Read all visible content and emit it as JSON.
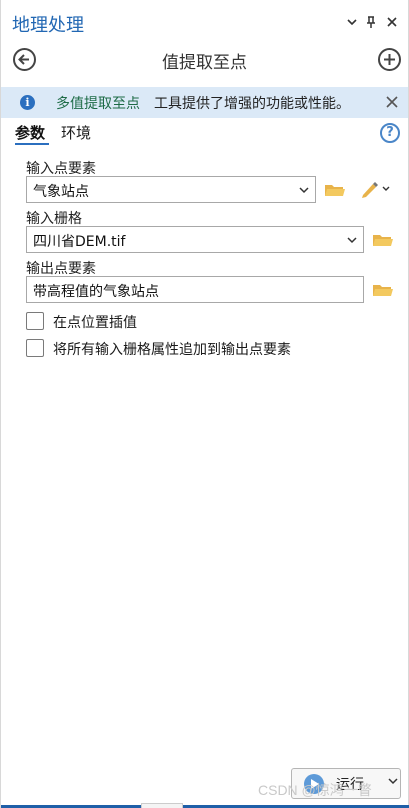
{
  "pane": {
    "title": "地理处理",
    "controls": {
      "menu_icon": "chevron-down-icon",
      "pin_icon": "pin-icon",
      "close_icon": "close-icon"
    }
  },
  "nav": {
    "tool_title": "值提取至点",
    "back_icon": "back-arrow-icon",
    "add_icon": "add-circle-icon"
  },
  "banner": {
    "link_text": "多值提取至点",
    "message": "工具提供了增强的功能或性能。",
    "icon": "info-icon"
  },
  "tabs": [
    {
      "label": "参数",
      "active": true
    },
    {
      "label": "环境",
      "active": false
    }
  ],
  "params": {
    "input_points": {
      "label": "输入点要素",
      "value": "气象站点"
    },
    "input_raster": {
      "label": "输入栅格",
      "value": "四川省DEM.tif"
    },
    "output_points": {
      "label": "输出点要素",
      "value": "带高程值的气象站点"
    },
    "checkboxes": [
      {
        "label": "在点位置插值",
        "checked": false
      },
      {
        "label": "将所有输入栅格属性追加到输出点要素",
        "checked": false
      }
    ]
  },
  "run": {
    "label": "运行"
  },
  "watermark": "CSDN @惊鸿一瞥",
  "colors": {
    "accent": "#2167b3",
    "banner_bg": "#dbe9f7",
    "link": "#1d6b46",
    "folder": "#e8b34a"
  }
}
